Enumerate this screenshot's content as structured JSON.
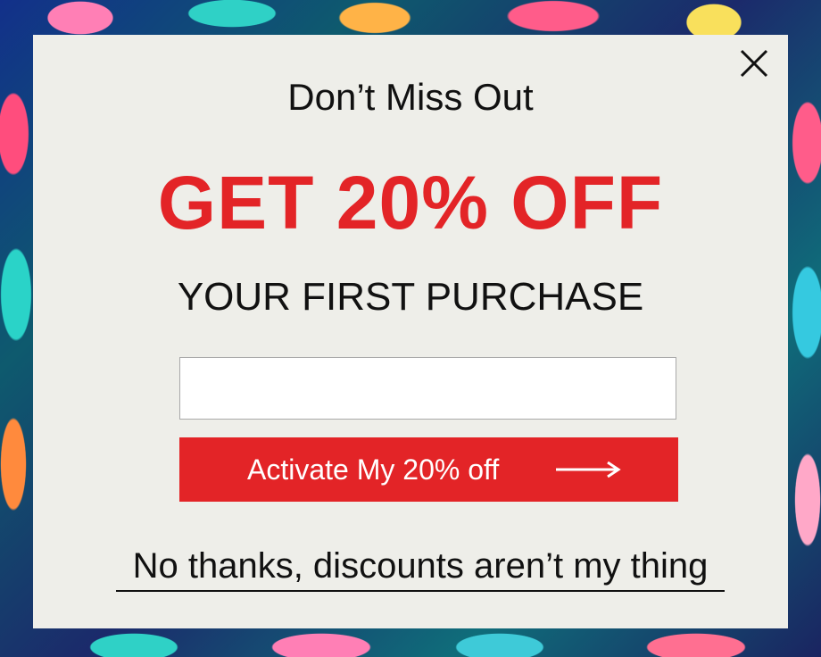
{
  "popup": {
    "headline": "Don’t Miss Out",
    "offer": "GET 20% OFF",
    "subheadline": "YOUR FIRST PURCHASE",
    "email_input": {
      "value": "",
      "placeholder": ""
    },
    "cta_label": "Activate My 20% off",
    "decline_link": "No thanks, discounts aren’t my thing"
  },
  "icons": {
    "close": "close-icon",
    "arrow": "arrow-right-icon"
  },
  "colors": {
    "accent": "#e32427",
    "modal_background": "#eeeee9",
    "text": "#111111"
  }
}
